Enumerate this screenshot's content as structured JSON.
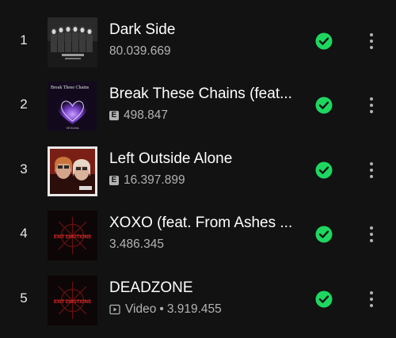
{
  "tracks": [
    {
      "number": "1",
      "title": "Dark Side",
      "explicit": false,
      "meta_prefix": "",
      "plays": "80.039.669"
    },
    {
      "number": "2",
      "title": "Break These Chains (feat...",
      "explicit": true,
      "meta_prefix": "",
      "plays": "498.847",
      "cover_text": "Break These Chains",
      "cover_footer": "VEXUNA"
    },
    {
      "number": "3",
      "title": "Left Outside Alone",
      "explicit": true,
      "meta_prefix": "",
      "plays": "16.397.899"
    },
    {
      "number": "4",
      "title": "XOXO (feat. From Ashes ...",
      "explicit": false,
      "meta_prefix": "",
      "plays": "3.486.345",
      "cover_text": "EXIT EMOTIONS"
    },
    {
      "number": "5",
      "title": "DEADZONE",
      "explicit": false,
      "meta_prefix": "Video",
      "plays": "3.919.455",
      "cover_text": "EXIT EMOTIONS"
    }
  ],
  "explicit_label": "E",
  "dot": "•",
  "icons": {
    "saved": "check-circle-icon",
    "more": "more-vertical-icon",
    "video": "video-play-icon"
  },
  "colors": {
    "background": "#121212",
    "accent_green": "#1ed760",
    "subtext": "#b3b3b3",
    "text": "#ffffff"
  }
}
